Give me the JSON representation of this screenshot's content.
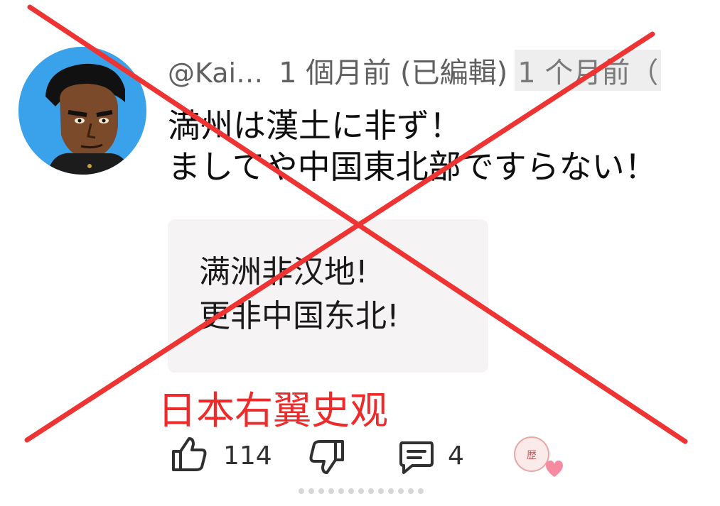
{
  "comment": {
    "author_handle": "@Kai…",
    "time_edited": "1 個月前 (已編輯)",
    "time_translated": "1 个月前（",
    "text_line1": "満州は漢土に非ず！",
    "text_line2": "ましてや中国東北部ですらない！"
  },
  "translation_box": {
    "line1": "满洲非汉地!",
    "line2": "更非中国东北!"
  },
  "annotation": {
    "caption": "日本右翼史观",
    "color": "#ee2a2a"
  },
  "actions": {
    "like_count": "114",
    "reply_count": "4"
  },
  "icons": [
    "avatar",
    "like-icon",
    "dislike-icon",
    "reply-icon",
    "creator-heart-icon"
  ],
  "colors": {
    "cross": "#ee3333",
    "meta_text": "#606060",
    "quote_bg": "#f5f3f3"
  }
}
